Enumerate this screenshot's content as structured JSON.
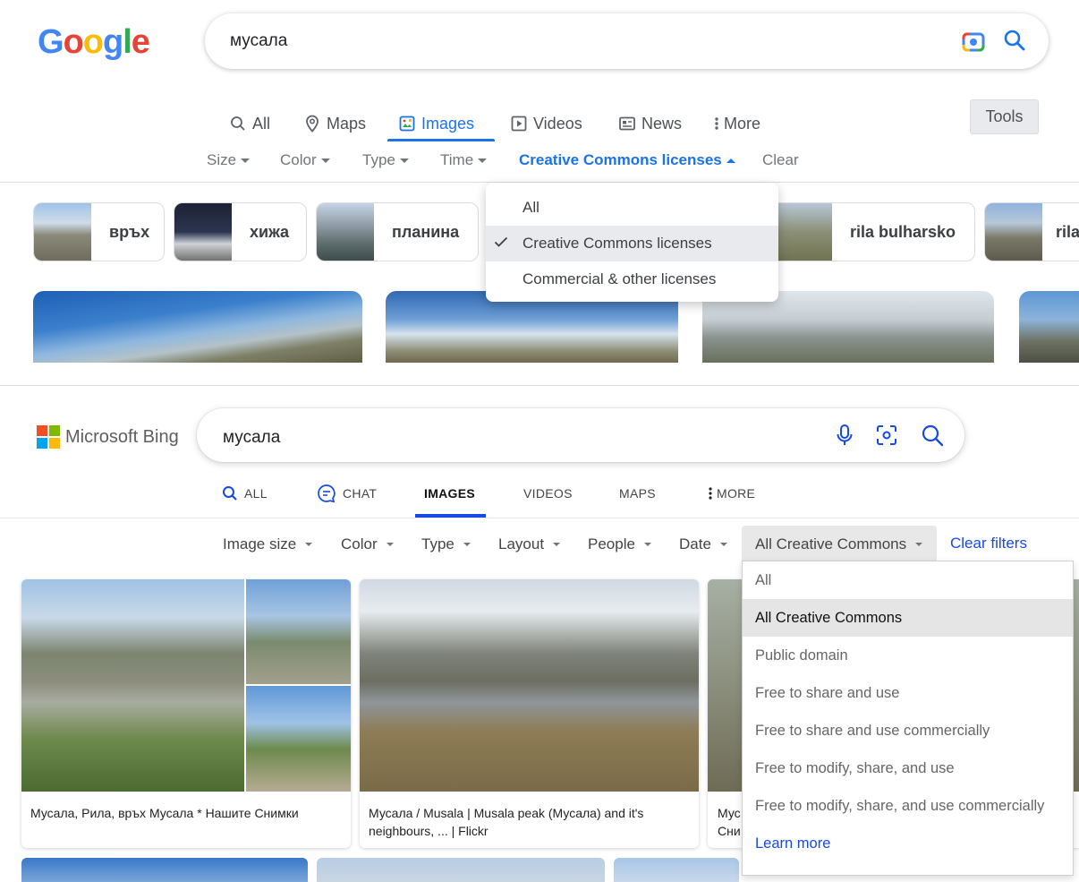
{
  "google": {
    "logo_letters": [
      {
        "ch": "G",
        "color": "#4285F4"
      },
      {
        "ch": "o",
        "color": "#EA4335"
      },
      {
        "ch": "o",
        "color": "#FBBC05"
      },
      {
        "ch": "g",
        "color": "#4285F4"
      },
      {
        "ch": "l",
        "color": "#34A853"
      },
      {
        "ch": "e",
        "color": "#EA4335"
      }
    ],
    "search_query": "мусала",
    "tabs": [
      {
        "label": "All",
        "icon": "search-icon"
      },
      {
        "label": "Maps",
        "icon": "map-pin-icon"
      },
      {
        "label": "Images",
        "icon": "image-icon",
        "active": true
      },
      {
        "label": "Videos",
        "icon": "play-icon"
      },
      {
        "label": "News",
        "icon": "news-icon"
      },
      {
        "label": "More",
        "icon": "more-vertical-icon"
      }
    ],
    "tools_label": "Tools",
    "filters": [
      "Size",
      "Color",
      "Type",
      "Time"
    ],
    "active_filter": "Creative Commons licenses",
    "clear_label": "Clear",
    "chips": [
      "връх",
      "хижа",
      "планина",
      "rila bulharsko",
      "rila"
    ],
    "license_dropdown": {
      "items": [
        "All",
        "Creative Commons licenses",
        "Commercial & other licenses"
      ],
      "selected": "Creative Commons licenses"
    }
  },
  "bing": {
    "logo_text": "Microsoft Bing",
    "logo_colors": [
      "#F25022",
      "#7FBA00",
      "#00A4EF",
      "#FFB900"
    ],
    "search_query": "мусала",
    "tabs": [
      {
        "label": "ALL",
        "icon": "search-icon"
      },
      {
        "label": "CHAT",
        "icon": "chat-icon"
      },
      {
        "label": "IMAGES",
        "active": true
      },
      {
        "label": "VIDEOS"
      },
      {
        "label": "MAPS"
      },
      {
        "label": "MORE",
        "icon": "more-vertical-icon"
      }
    ],
    "filters": [
      "Image size",
      "Color",
      "Type",
      "Layout",
      "People",
      "Date",
      "All Creative Commons"
    ],
    "clear_filters_label": "Clear filters",
    "accent_color": "#174AE4",
    "results": [
      {
        "caption": "Мусала, Рила, връх Мусала * Нашите Снимки"
      },
      {
        "caption": "Мусала / Musala | Musala peak (Мусала) and it's neighbours, ... | Flickr"
      },
      {
        "caption": "Мус Сни"
      }
    ],
    "license_dropdown": {
      "items": [
        "All",
        "All Creative Commons",
        "Public domain",
        "Free to share and use",
        "Free to share and use commercially",
        "Free to modify, share, and use",
        "Free to modify, share, and use commercially"
      ],
      "selected": "All Creative Commons",
      "learn_more": "Learn more"
    }
  }
}
